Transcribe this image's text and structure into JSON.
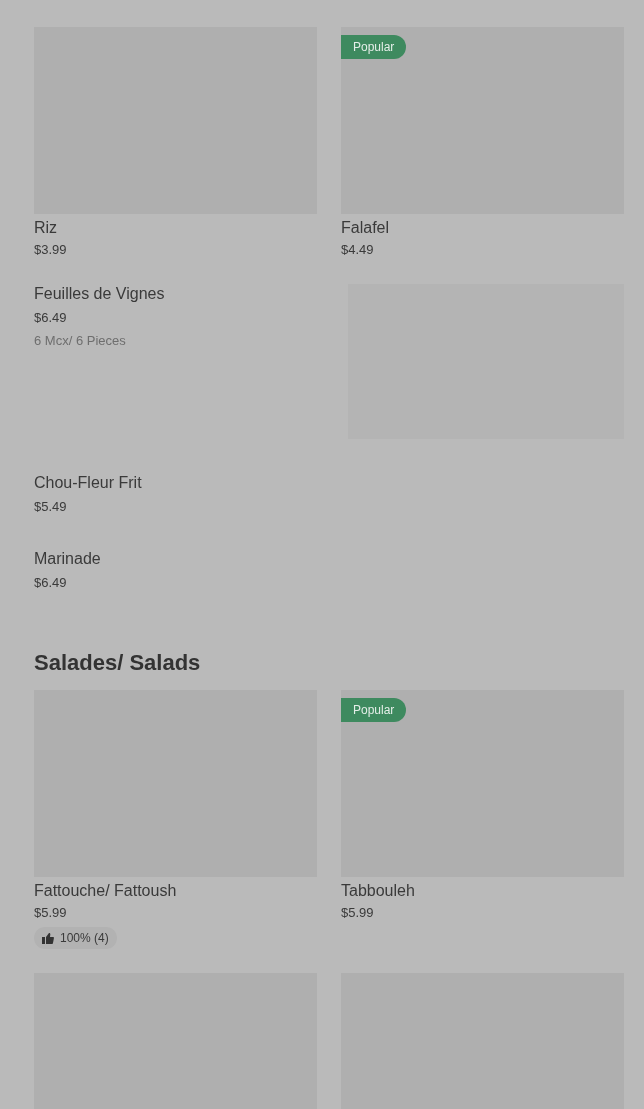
{
  "sections": [
    {
      "items": [
        {
          "kind": "grid",
          "name": "Riz",
          "price": "$3.99"
        },
        {
          "kind": "grid",
          "name": "Falafel",
          "price": "$4.49",
          "badge": "Popular"
        },
        {
          "kind": "row",
          "name": "Feuilles de Vignes",
          "price": "$6.49",
          "description": "6 Mcx/ 6 Pieces",
          "image": true
        },
        {
          "kind": "row",
          "name": "Chou-Fleur Frit",
          "price": "$5.49",
          "image": false
        },
        {
          "kind": "row",
          "name": "Marinade",
          "price": "$6.49",
          "image": false
        }
      ]
    },
    {
      "title": "Salades/ Salads",
      "items": [
        {
          "kind": "grid",
          "name": "Fattouche/ Fattoush",
          "price": "$5.99",
          "rating": "100% (4)"
        },
        {
          "kind": "grid",
          "name": "Tabbouleh",
          "price": "$5.99",
          "badge": "Popular"
        },
        {
          "kind": "grid"
        },
        {
          "kind": "grid"
        }
      ]
    }
  ]
}
